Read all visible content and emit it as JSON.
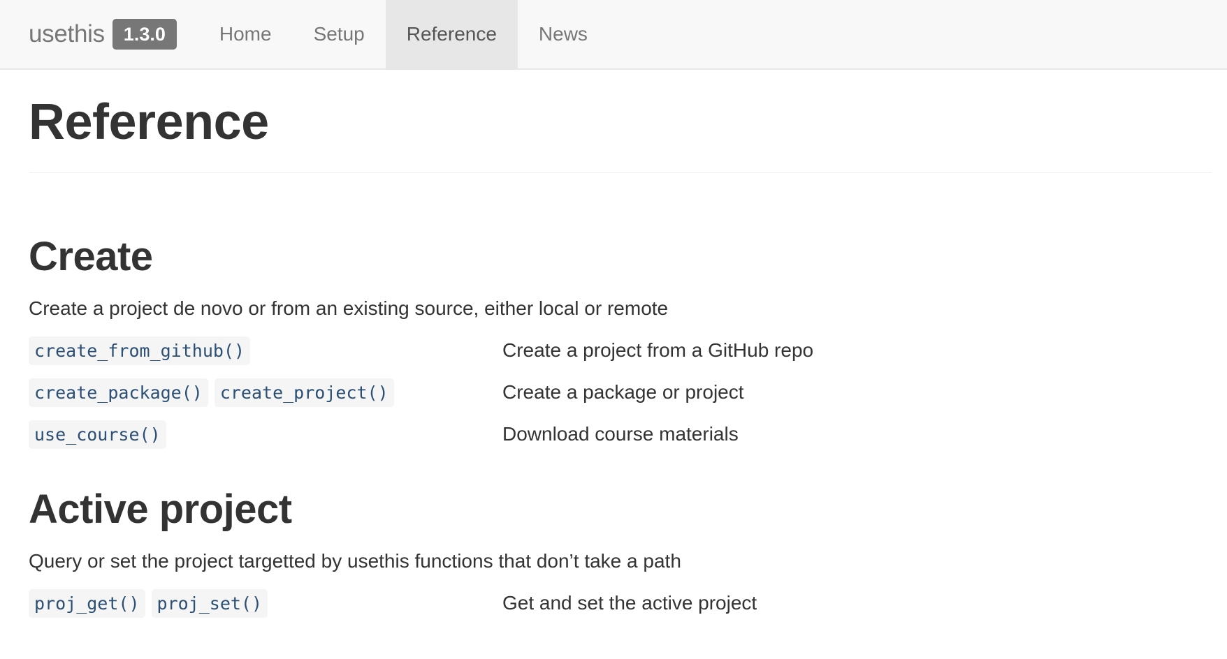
{
  "navbar": {
    "brand": "usethis",
    "version": "1.3.0",
    "items": [
      {
        "label": "Home"
      },
      {
        "label": "Setup"
      },
      {
        "label": "Reference"
      },
      {
        "label": "News"
      }
    ]
  },
  "page": {
    "title": "Reference"
  },
  "sections": {
    "create": {
      "title": "Create",
      "description": "Create a project de novo or from an existing source, either local or remote",
      "rows": [
        {
          "funcs": [
            "create_from_github()"
          ],
          "description": "Create a project from a GitHub repo"
        },
        {
          "funcs": [
            "create_package()",
            "create_project()"
          ],
          "description": "Create a package or project"
        },
        {
          "funcs": [
            "use_course()"
          ],
          "description": "Download course materials"
        }
      ]
    },
    "active": {
      "title": "Active project",
      "description": "Query or set the project targetted by usethis functions that don’t take a path",
      "rows": [
        {
          "funcs": [
            "proj_get()",
            "proj_set()"
          ],
          "description": "Get and set the active project"
        }
      ]
    }
  }
}
